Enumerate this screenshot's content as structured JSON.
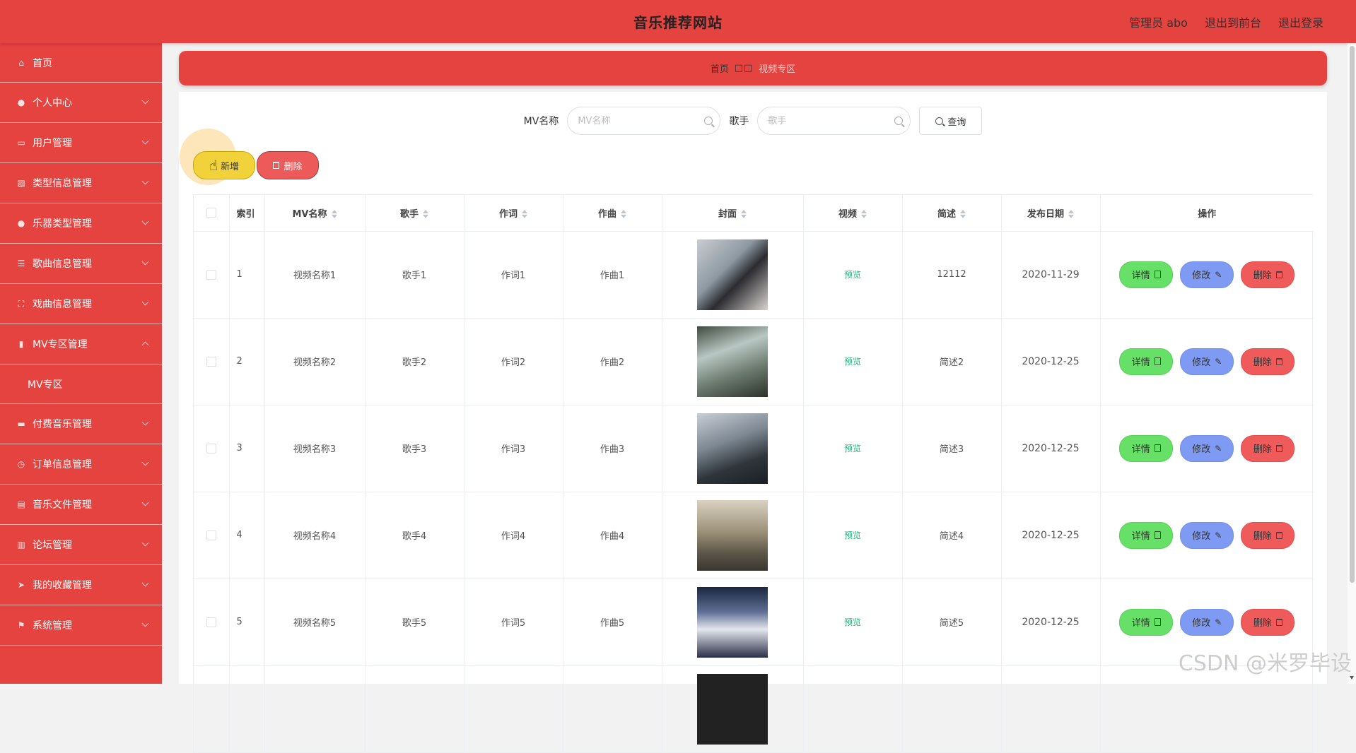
{
  "header": {
    "title": "音乐推荐网站",
    "admin_label": "管理员 abo",
    "exit_front": "退出到前台",
    "logout": "退出登录"
  },
  "sidebar": {
    "items": [
      {
        "label": "首页",
        "icon": "home-icon"
      },
      {
        "label": "个人中心",
        "icon": "user-icon"
      },
      {
        "label": "用户管理",
        "icon": "card-icon"
      },
      {
        "label": "类型信息管理",
        "icon": "chart-icon"
      },
      {
        "label": "乐器类型管理",
        "icon": "location-icon"
      },
      {
        "label": "歌曲信息管理",
        "icon": "sliders-icon"
      },
      {
        "label": "戏曲信息管理",
        "icon": "frame-icon"
      },
      {
        "label": "MV专区管理",
        "icon": "bars-icon"
      },
      {
        "label": "MV专区",
        "icon": ""
      },
      {
        "label": "付费音乐管理",
        "icon": "monitor-icon"
      },
      {
        "label": "订单信息管理",
        "icon": "clock-icon"
      },
      {
        "label": "音乐文件管理",
        "icon": "doc-icon"
      },
      {
        "label": "论坛管理",
        "icon": "trash-icon"
      },
      {
        "label": "我的收藏管理",
        "icon": "send-icon"
      },
      {
        "label": "系统管理",
        "icon": "flag-icon"
      }
    ]
  },
  "breadcrumb": {
    "home": "首页",
    "sep": "□□",
    "current": "视频专区"
  },
  "search": {
    "mv_label": "MV名称",
    "mv_placeholder": "MV名称",
    "singer_label": "歌手",
    "singer_placeholder": "歌手",
    "query_label": "查询"
  },
  "actions": {
    "add_label": "新增",
    "delete_label": "删除"
  },
  "table": {
    "headers": [
      "索引",
      "MV名称",
      "歌手",
      "作词",
      "作曲",
      "封面",
      "视频",
      "简述",
      "发布日期",
      "操作"
    ],
    "rows": [
      {
        "idx": "1",
        "name": "视频名称1",
        "singer": "歌手1",
        "lyric": "作词1",
        "compose": "作曲1",
        "video": "预览",
        "desc": "12112",
        "date": "2020-11-29"
      },
      {
        "idx": "2",
        "name": "视频名称2",
        "singer": "歌手2",
        "lyric": "作词2",
        "compose": "作曲2",
        "video": "预览",
        "desc": "简述2",
        "date": "2020-12-25"
      },
      {
        "idx": "3",
        "name": "视频名称3",
        "singer": "歌手3",
        "lyric": "作词3",
        "compose": "作曲3",
        "video": "预览",
        "desc": "简述3",
        "date": "2020-12-25"
      },
      {
        "idx": "4",
        "name": "视频名称4",
        "singer": "歌手4",
        "lyric": "作词4",
        "compose": "作曲4",
        "video": "预览",
        "desc": "简述4",
        "date": "2020-12-25"
      },
      {
        "idx": "5",
        "name": "视频名称5",
        "singer": "歌手5",
        "lyric": "作词5",
        "compose": "作曲5",
        "video": "预览",
        "desc": "简述5",
        "date": "2020-12-25"
      }
    ],
    "op_detail": "详情",
    "op_edit": "修改",
    "op_delete": "删除"
  },
  "watermark": "CSDN @米罗毕设",
  "colors": {
    "brand": "#e54340",
    "add_button": "#f2d23a",
    "delete_button": "#ec5a5a",
    "detail_button": "#67e067",
    "edit_button": "#7f9af2",
    "preview_link": "#2bb07a"
  }
}
